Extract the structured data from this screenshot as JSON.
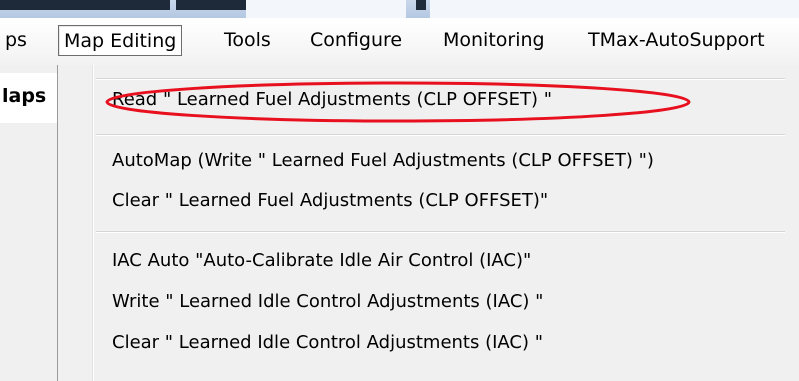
{
  "menubar": {
    "items": [
      {
        "label": "ps"
      },
      {
        "label": "Map Editing"
      },
      {
        "label": "Tools"
      },
      {
        "label": "Configure"
      },
      {
        "label": "Monitoring"
      },
      {
        "label": "TMax-AutoSupport"
      }
    ]
  },
  "left_pane": {
    "tab_label": "laps"
  },
  "dropdown": {
    "items": [
      {
        "label": "Read  \" Learned Fuel Adjustments (CLP OFFSET) \""
      },
      {
        "label": "AutoMap  (Write  \" Learned Fuel Adjustments (CLP OFFSET) \")"
      },
      {
        "label": "Clear  \" Learned Fuel Adjustments (CLP OFFSET)\""
      },
      {
        "label": "IAC Auto \"Auto-Calibrate Idle Air Control (IAC)\""
      },
      {
        "label": "Write  \" Learned Idle Control Adjustments (IAC) \""
      },
      {
        "label": "Clear  \" Learned Idle Control Adjustments (IAC) \""
      }
    ]
  },
  "colors": {
    "annotation": "#e8101e"
  }
}
